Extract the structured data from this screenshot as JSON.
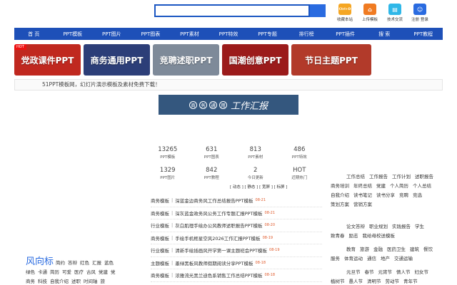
{
  "header": {
    "search_placeholder": "",
    "tools": [
      {
        "label": "收藏本站",
        "icon": "bookmark-icon",
        "color": "#f5a623",
        "glyph": "Ctrl+D"
      },
      {
        "label": "上传模板",
        "icon": "upload-icon",
        "color": "#f07b22",
        "glyph": "⌂"
      },
      {
        "label": "技术交流",
        "icon": "chat-icon",
        "color": "#2fb7e8",
        "glyph": "▤"
      },
      {
        "label": "注册 登录",
        "icon": "user-icon",
        "color": "#2a6be0",
        "glyph": "☺"
      }
    ]
  },
  "nav": [
    "首 页",
    "PPT模板",
    "PPT图片",
    "PPT图表",
    "PPT素材",
    "PPT特效",
    "PPT专题",
    "排行榜",
    "PPT插件",
    "搜 索",
    "PPT教程"
  ],
  "banners": [
    {
      "text": "党政课件PPT",
      "color": "#c0281f",
      "hot": "HOT"
    },
    {
      "text": "商务通用PPT",
      "color": "#2c3e78",
      "hot": ""
    },
    {
      "text": "竞聘述职PPT",
      "color": "#7e8a99",
      "hot": ""
    },
    {
      "text": "国潮创意PPT",
      "color": "#9b1b1b",
      "hot": ""
    },
    {
      "text": "节日主题PPT",
      "color": "#b23a2a",
      "hot": ""
    }
  ],
  "notice": "51PPT模板网，幻灯片演示模板及素材免费下载！",
  "center_logo": {
    "chars": [
      "商",
      "务",
      "通",
      "用"
    ],
    "script": "工作汇报"
  },
  "stats": [
    {
      "num": "13265",
      "label": "PPT模板"
    },
    {
      "num": "631",
      "label": "PPT图表"
    },
    {
      "num": "813",
      "label": "PPT素材"
    },
    {
      "num": "486",
      "label": "PPT特效"
    },
    {
      "num": "1329",
      "label": "PPT图片"
    },
    {
      "num": "842",
      "label": "PPT教程"
    },
    {
      "num": "2",
      "label": "今日更新"
    },
    {
      "num": "HOT",
      "label": "近期热门"
    }
  ],
  "mid_links": "[ 动态 ] [ 静态 ] [ 宽屏 ] [ 标屏 ]",
  "list": [
    {
      "cat": "商务模板",
      "title": "深蓝金边商务风工作总结报告PPT模板",
      "date": "08-21"
    },
    {
      "cat": "商务模板",
      "title": "深灰蓝金政务风公务工作专题汇报PPT模板",
      "date": "08-21"
    },
    {
      "cat": "行业模板",
      "title": "灰白肌理手绘办公风教师述职报告PPT模板",
      "date": "08-20"
    },
    {
      "cat": "商务模板",
      "title": "手绘手机框星空风2026工作汇报PPT模板",
      "date": "08-19"
    },
    {
      "cat": "行业模板",
      "title": "清新手绘插画风开学第一课主题班会PPT模板",
      "date": "08-19"
    },
    {
      "cat": "主题模板",
      "title": "墨绿黑板风教师假期阅读分享PPT模板",
      "date": "08-18"
    },
    {
      "cat": "商务模板",
      "title": "浓雅流光黑兰迪色系销售工作总结PPT模板",
      "date": "08-18"
    },
    {
      "cat": "商务模板",
      "title": "",
      "date": ""
    }
  ],
  "left_tags": {
    "title": "风向标",
    "tags": [
      "简约",
      "答辩",
      "红色",
      "汇报",
      "蓝色",
      "绿色",
      "卡通",
      "简历",
      "可爱",
      "医疗",
      "古风",
      "党建",
      "党",
      "商务",
      "科技",
      "自我介绍",
      "述职",
      "时间轴",
      "旅"
    ]
  },
  "right_groups": [
    {
      "title": "",
      "tags": [
        "工作总结",
        "工作报告",
        "工作计划",
        "述职报告",
        "商务培训",
        "年终总结",
        "党建",
        "个人简历",
        "个人总结",
        "自我介绍",
        "读书笔记",
        "读书分享",
        "竞聘",
        "竞选",
        "策划方案",
        "营销方案"
      ]
    },
    {
      "title": "",
      "tags": [
        "论文答辩",
        "职业规划",
        "实践报告",
        "学生",
        "致青春",
        "励志",
        "我给母校送模板"
      ]
    },
    {
      "title": "",
      "tags": [
        "教育",
        "旅游",
        "金融",
        "医药卫生",
        "建筑",
        "餐饮",
        "服务",
        "体育运动",
        "通信",
        "地产",
        "交通运输"
      ]
    },
    {
      "title": "",
      "tags": [
        "元旦节",
        "春节",
        "元宵节",
        "情人节",
        "妇女节",
        "植树节",
        "愚人节",
        "清明节",
        "劳动节",
        "青年节"
      ]
    }
  ]
}
